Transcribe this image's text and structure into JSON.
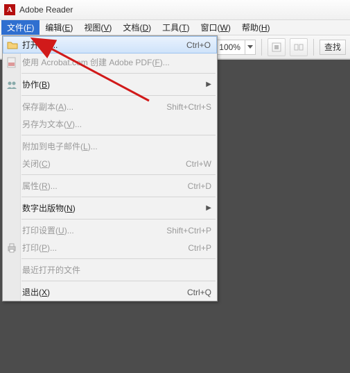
{
  "title": "Adobe Reader",
  "menu": {
    "file": {
      "label": "文件",
      "mn": "F"
    },
    "edit": {
      "label": "编辑",
      "mn": "E"
    },
    "view": {
      "label": "视图",
      "mn": "V"
    },
    "doc": {
      "label": "文档",
      "mn": "D"
    },
    "tools": {
      "label": "工具",
      "mn": "T"
    },
    "window": {
      "label": "窗口",
      "mn": "W"
    },
    "help": {
      "label": "帮助",
      "mn": "H"
    }
  },
  "toolbar": {
    "zoom": "100%",
    "search": "查找"
  },
  "fileMenu": {
    "open": {
      "label": "打开",
      "mn": "O",
      "suffix": "...",
      "shortcut": "Ctrl+O"
    },
    "createPdf": {
      "label": "使用 Acrobat.com 创建 Adobe PDF",
      "mn": "F",
      "suffix": "..."
    },
    "collab": {
      "label": "协作",
      "mn": "B"
    },
    "saveCopy": {
      "label": "保存副本",
      "mn": "A",
      "suffix": "...",
      "shortcut": "Shift+Ctrl+S"
    },
    "saveAsText": {
      "label": "另存为文本",
      "mn": "V",
      "suffix": "..."
    },
    "attachEmail": {
      "label": "附加到电子邮件",
      "mn": "L",
      "suffix": "..."
    },
    "close": {
      "label": "关闭",
      "mn": "C",
      "shortcut": "Ctrl+W"
    },
    "properties": {
      "label": "属性",
      "mn": "R",
      "suffix": "...",
      "shortcut": "Ctrl+D"
    },
    "digitalPub": {
      "label": "数字出版物",
      "mn": "N"
    },
    "printSetup": {
      "label": "打印设置",
      "mn": "U",
      "suffix": "...",
      "shortcut": "Shift+Ctrl+P"
    },
    "print": {
      "label": "打印",
      "mn": "P",
      "suffix": "...",
      "shortcut": "Ctrl+P"
    },
    "recent": {
      "label": "最近打开的文件"
    },
    "exit": {
      "label": "退出",
      "mn": "X",
      "shortcut": "Ctrl+Q"
    }
  },
  "colors": {
    "highlight": "#2f6fd0",
    "annotation": "#d11a1a"
  }
}
